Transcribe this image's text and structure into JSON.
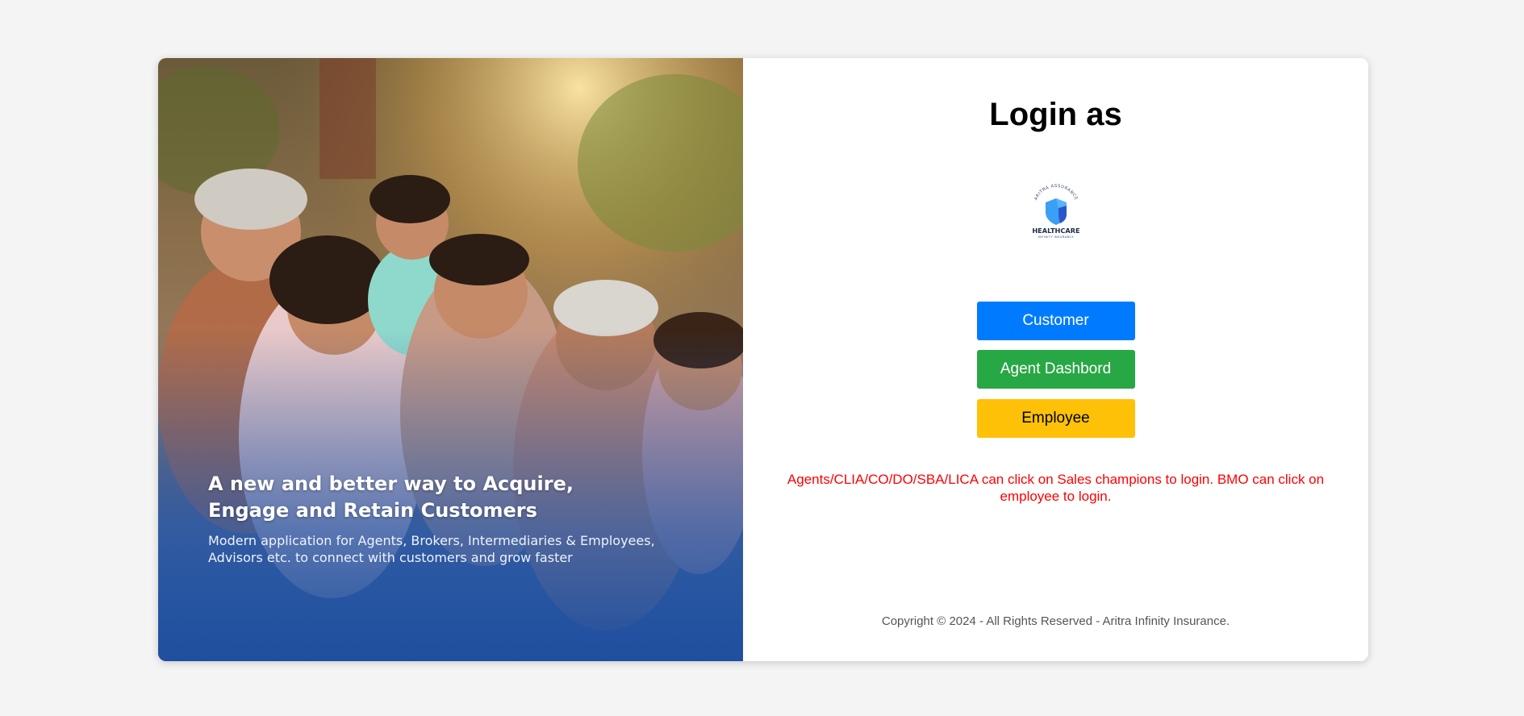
{
  "hero": {
    "heading_line1": "A new and better way to Acquire,",
    "heading_line2": "Engage and Retain Customers",
    "sub_line1": "Modern application for Agents, Brokers, Intermediaries & Employees,",
    "sub_line2": "Advisors etc. to connect with customers and grow faster"
  },
  "panel": {
    "title": "Login as",
    "logo": {
      "arc_text": "ARITRA ASSURANCE",
      "name": "HEALTHCARE",
      "tagline": "INFINITY INSURANCE",
      "icon": "shield-icon"
    },
    "buttons": {
      "customer": "Customer",
      "agent": "Agent Dashbord",
      "employee": "Employee"
    },
    "notice": "Agents/CLIA/CO/DO/SBA/LICA can click on Sales champions to login. BMO can click on employee to login.",
    "copyright": "Copyright © 2024 - All Rights Reserved - Aritra Infinity Insurance."
  },
  "colors": {
    "customer": "#007bff",
    "agent": "#28a745",
    "employee": "#ffc107",
    "notice": "#ff0000",
    "hero_gradient_bottom": "#1f4f9e"
  }
}
